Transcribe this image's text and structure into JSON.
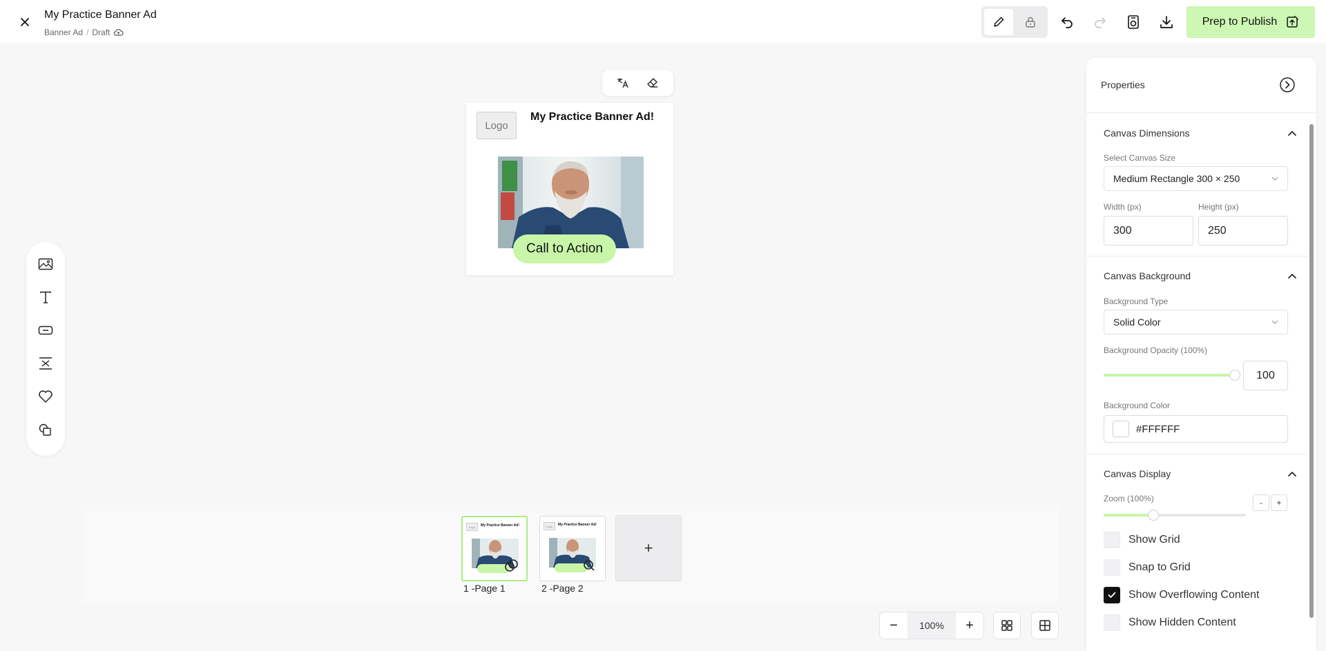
{
  "header": {
    "title": "My Practice Banner Ad",
    "breadcrumb_type": "Banner Ad",
    "breadcrumb_sep": "/",
    "breadcrumb_status": "Draft",
    "publish_label": "Prep to Publish"
  },
  "left_toolbar": {
    "tools": [
      "image-icon",
      "text-icon",
      "button-icon",
      "spacing-icon",
      "heart-icon",
      "shapes-icon"
    ]
  },
  "banner": {
    "logo_text": "Logo",
    "headline": "My Practice Banner Ad!",
    "cta_label": "Call to Action"
  },
  "pages": [
    {
      "label": "1 -Page 1",
      "logo_text": "Logo",
      "headline": "My Practice Banner Ad!"
    },
    {
      "label": "2 -Page 2",
      "logo_text": "Logo",
      "headline": "My Practice Banner Ad!"
    }
  ],
  "add_page_label": "+",
  "zoom_controls": {
    "minus": "−",
    "value": "100%",
    "plus": "+"
  },
  "properties": {
    "title": "Properties",
    "canvas_dimensions": {
      "heading": "Canvas Dimensions",
      "size_label": "Select Canvas Size",
      "size_value": "Medium Rectangle 300 × 250",
      "width_label": "Width (px)",
      "width_value": "300",
      "height_label": "Height (px)",
      "height_value": "250"
    },
    "canvas_background": {
      "heading": "Canvas Background",
      "type_label": "Background Type",
      "type_value": "Solid Color",
      "opacity_label": "Background Opacity (100%)",
      "opacity_value": "100",
      "opacity_fraction": 1.0,
      "color_label": "Background Color",
      "color_value": "#FFFFFF"
    },
    "canvas_display": {
      "heading": "Canvas Display",
      "zoom_label": "Zoom (100%)",
      "zoom_fraction": 0.35,
      "zoom_minus": "-",
      "zoom_plus": "+",
      "options": [
        {
          "label": "Show Grid",
          "checked": false
        },
        {
          "label": "Snap to Grid",
          "checked": false
        },
        {
          "label": "Show Overflowing Content",
          "checked": true
        },
        {
          "label": "Show Hidden Content",
          "checked": false
        }
      ]
    }
  },
  "colors": {
    "accent_green": "#c8f5a8",
    "publish_green": "#cdf7b4",
    "text_dark": "#111111"
  }
}
